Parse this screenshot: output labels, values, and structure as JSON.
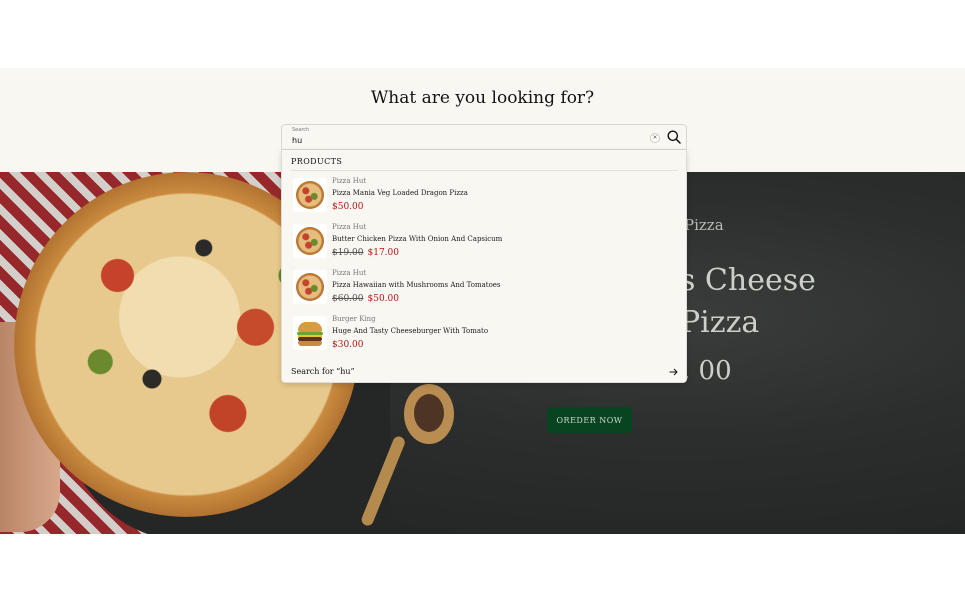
{
  "search": {
    "heading": "What are you looking for?",
    "label": "Search",
    "value": "hu",
    "clear_label": "×"
  },
  "dropdown": {
    "heading": "PRODUCTS",
    "products": [
      {
        "brand": "Pizza Hut",
        "name": "Pizza Mania Veg Loaded Dragon Pizza",
        "old_price": "",
        "price": "$50.00",
        "image": "pizza"
      },
      {
        "brand": "Pizza Hut",
        "name": "Butter Chicken Pizza With Onion And Capsicum",
        "old_price": "$19.00",
        "price": "$17.00",
        "image": "pizza"
      },
      {
        "brand": "Pizza Hut",
        "name": "Pizza Hawaiian with Mushrooms And Tomatoes",
        "old_price": "$60.00",
        "price": "$50.00",
        "image": "pizza"
      },
      {
        "brand": "Burger King",
        "name": "Huge And Tasty Cheeseburger With Tomato",
        "old_price": "",
        "price": "$30.00",
        "image": "burger"
      }
    ],
    "footer": "Search for “hu”"
  },
  "hero": {
    "subtitle": "Pizza",
    "title_line1": "s Cheese",
    "title_line2": "Pizza",
    "price": ", 00",
    "order_button": "OREDER NOW"
  },
  "colors": {
    "band_bg": "#f9f7f2",
    "price_red": "#b01919",
    "order_green": "#07441f"
  }
}
